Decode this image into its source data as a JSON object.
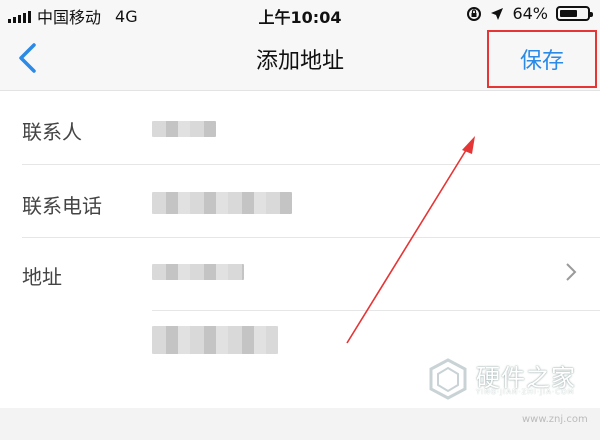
{
  "status_bar": {
    "carrier": "中国移动",
    "network": "4G",
    "time": "上午10:04",
    "battery_pct": "64%",
    "battery_level": 0.64
  },
  "nav": {
    "title": "添加地址",
    "save_label": "保存"
  },
  "form": {
    "contact_label": "联系人",
    "phone_label": "联系电话",
    "address_label": "地址"
  },
  "watermark": {
    "name": "硬件之家",
    "sub": "YING·JIAN·ZHI·JIA·COM",
    "url": "www.znj.com"
  },
  "icons": {
    "back": "chevron-left-icon",
    "row_more": "chevron-right-icon",
    "annotation": "arrow-icon"
  },
  "colors": {
    "accent": "#2a8ae6",
    "highlight": "#e53535"
  }
}
